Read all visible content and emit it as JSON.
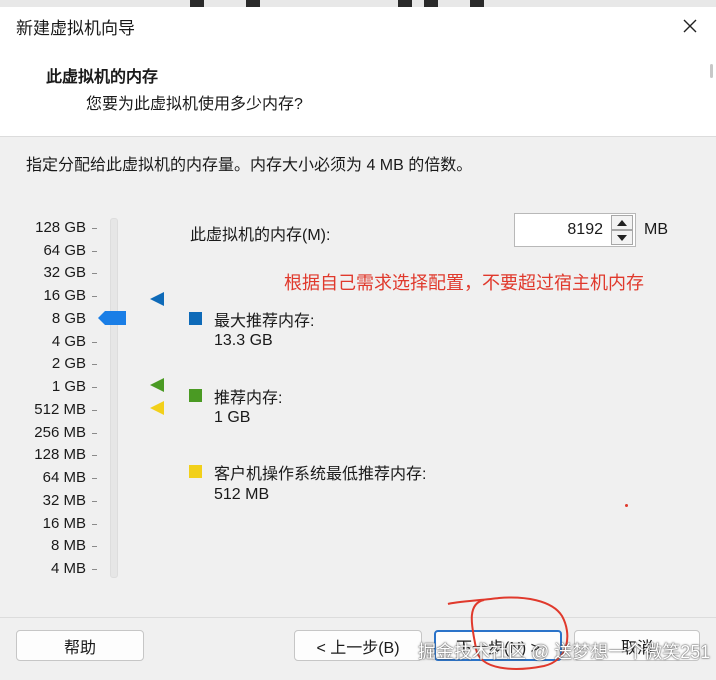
{
  "window": {
    "title": "新建虚拟机向导"
  },
  "header": {
    "title": "此虚拟机的内存",
    "subtitle": "您要为此虚拟机使用多少内存?"
  },
  "instruction": "指定分配给此虚拟机的内存量。内存大小必须为 4 MB 的倍数。",
  "memory_scale": {
    "labels": [
      "128 GB",
      "64 GB",
      "32 GB",
      "16 GB",
      "8 GB",
      "4 GB",
      "2 GB",
      "1 GB",
      "512 MB",
      "256 MB",
      "128 MB",
      "64 MB",
      "32 MB",
      "16 MB",
      "8 MB",
      "4 MB"
    ],
    "selected": "8 GB"
  },
  "memory_field": {
    "label": "此虚拟机的内存(M):",
    "value": "8192",
    "unit": "MB"
  },
  "annotation": "根据自己需求选择配置，不要超过宿主机内存",
  "legend": {
    "max_recommended": {
      "title": "最大推荐内存:",
      "value": "13.3 GB",
      "color": "#0e6ab8"
    },
    "recommended": {
      "title": "推荐内存:",
      "value": "1 GB",
      "color": "#4a9a23"
    },
    "guest_min": {
      "title": "客户机操作系统最低推荐内存:",
      "value": "512 MB",
      "color": "#f2d01a"
    }
  },
  "slider_color": "#1a7ee6",
  "footer": {
    "help": "帮助",
    "back": "< 上一步(B)",
    "next": "下一步(N) >",
    "cancel": "取消"
  },
  "watermark": "掘金技术社区 @ 送梦想一个微笑251",
  "icons": {
    "close": "close-icon",
    "spin_up": "arrow-up-icon",
    "spin_down": "arrow-down-icon"
  }
}
